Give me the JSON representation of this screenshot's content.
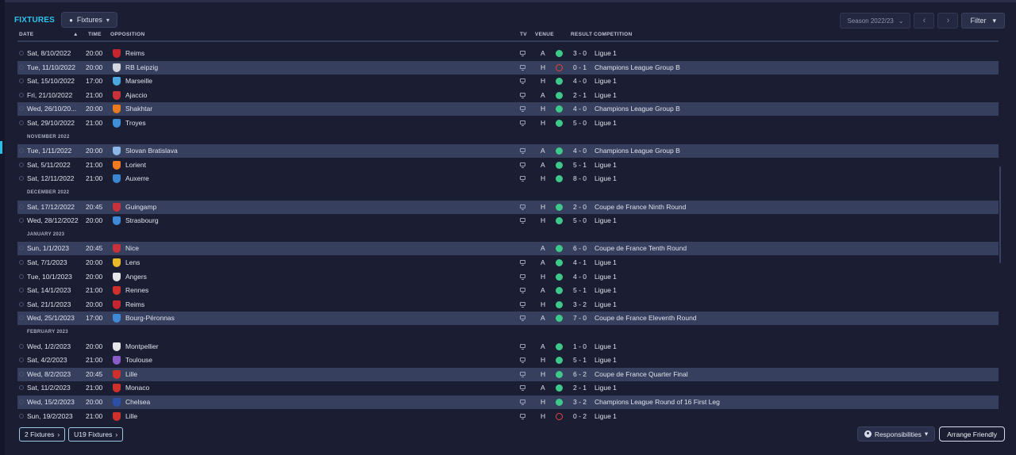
{
  "header": {
    "title": "FIXTURES",
    "view_dropdown": "Fixtures",
    "season": "Season 2022/23",
    "filter": "Filter"
  },
  "columns": {
    "date": "DATE",
    "time": "TIME",
    "opposition": "OPPOSITION",
    "tv": "TV",
    "venue": "VENUE",
    "result": "RESULT",
    "competition": "COMPETITION"
  },
  "rows": [
    {
      "type": "fixture",
      "date": "Sat, 8/10/2022",
      "time": "20:00",
      "opp": "Reims",
      "crest": "#c4252f",
      "tv": true,
      "venue": "A",
      "outcome": "win",
      "score": "3 - 0",
      "comp": "Ligue 1",
      "alt": false
    },
    {
      "type": "fixture",
      "date": "Tue, 11/10/2022",
      "time": "20:00",
      "opp": "RB Leipzig",
      "crest": "#d6d6e0",
      "tv": true,
      "venue": "H",
      "outcome": "loss",
      "score": "0 - 1",
      "comp": "Champions League Group B",
      "alt": true
    },
    {
      "type": "fixture",
      "date": "Sat, 15/10/2022",
      "time": "17:00",
      "opp": "Marseille",
      "crest": "#4aa8de",
      "tv": true,
      "venue": "H",
      "outcome": "win",
      "score": "4 - 0",
      "comp": "Ligue 1",
      "alt": false
    },
    {
      "type": "fixture",
      "date": "Fri, 21/10/2022",
      "time": "21:00",
      "opp": "Ajaccio",
      "crest": "#c8323a",
      "tv": true,
      "venue": "A",
      "outcome": "win",
      "score": "2 - 1",
      "comp": "Ligue 1",
      "alt": false
    },
    {
      "type": "fixture",
      "date": "Wed, 26/10/20...",
      "time": "20:00",
      "opp": "Shakhtar",
      "crest": "#e87a1c",
      "tv": true,
      "venue": "H",
      "outcome": "win",
      "score": "4 - 0",
      "comp": "Champions League Group B",
      "alt": true
    },
    {
      "type": "fixture",
      "date": "Sat, 29/10/2022",
      "time": "21:00",
      "opp": "Troyes",
      "crest": "#3f8fd8",
      "tv": true,
      "venue": "H",
      "outcome": "win",
      "score": "5 - 0",
      "comp": "Ligue 1",
      "alt": false
    },
    {
      "type": "month",
      "label": "NOVEMBER 2022"
    },
    {
      "type": "fixture",
      "date": "Tue, 1/11/2022",
      "time": "20:00",
      "opp": "Slovan Bratislava",
      "crest": "#8ab6e8",
      "tv": true,
      "venue": "A",
      "outcome": "win",
      "score": "4 - 0",
      "comp": "Champions League Group B",
      "alt": true
    },
    {
      "type": "fixture",
      "date": "Sat, 5/11/2022",
      "time": "21:00",
      "opp": "Lorient",
      "crest": "#f07a22",
      "tv": true,
      "venue": "A",
      "outcome": "win",
      "score": "5 - 1",
      "comp": "Ligue 1",
      "alt": false
    },
    {
      "type": "fixture",
      "date": "Sat, 12/11/2022",
      "time": "21:00",
      "opp": "Auxerre",
      "crest": "#3a86d0",
      "tv": true,
      "venue": "H",
      "outcome": "win",
      "score": "8 - 0",
      "comp": "Ligue 1",
      "alt": false
    },
    {
      "type": "month",
      "label": "DECEMBER 2022"
    },
    {
      "type": "fixture",
      "date": "Sat, 17/12/2022",
      "time": "20:45",
      "opp": "Guingamp",
      "crest": "#c8323a",
      "tv": true,
      "venue": "H",
      "outcome": "win",
      "score": "2 - 0",
      "comp": "Coupe de France Ninth Round",
      "alt": true
    },
    {
      "type": "fixture",
      "date": "Wed, 28/12/2022",
      "time": "20:00",
      "opp": "Strasbourg",
      "crest": "#3e8ad6",
      "tv": true,
      "venue": "H",
      "outcome": "win",
      "score": "5 - 0",
      "comp": "Ligue 1",
      "alt": false
    },
    {
      "type": "month",
      "label": "JANUARY 2023"
    },
    {
      "type": "fixture",
      "date": "Sun, 1/1/2023",
      "time": "20:45",
      "opp": "Nice",
      "crest": "#c8323a",
      "tv": false,
      "venue": "A",
      "outcome": "win",
      "score": "6 - 0",
      "comp": "Coupe de France Tenth Round",
      "alt": true
    },
    {
      "type": "fixture",
      "date": "Sat, 7/1/2023",
      "time": "20:00",
      "opp": "Lens",
      "crest": "#e8b828",
      "tv": true,
      "venue": "A",
      "outcome": "win",
      "score": "4 - 1",
      "comp": "Ligue 1",
      "alt": false
    },
    {
      "type": "fixture",
      "date": "Tue, 10/1/2023",
      "time": "20:00",
      "opp": "Angers",
      "crest": "#e6e6ea",
      "tv": true,
      "venue": "H",
      "outcome": "win",
      "score": "4 - 0",
      "comp": "Ligue 1",
      "alt": false
    },
    {
      "type": "fixture",
      "date": "Sat, 14/1/2023",
      "time": "21:00",
      "opp": "Rennes",
      "crest": "#d0302c",
      "tv": true,
      "venue": "A",
      "outcome": "win",
      "score": "5 - 1",
      "comp": "Ligue 1",
      "alt": false
    },
    {
      "type": "fixture",
      "date": "Sat, 21/1/2023",
      "time": "20:00",
      "opp": "Reims",
      "crest": "#c4252f",
      "tv": true,
      "venue": "H",
      "outcome": "win",
      "score": "3 - 2",
      "comp": "Ligue 1",
      "alt": false
    },
    {
      "type": "fixture",
      "date": "Wed, 25/1/2023",
      "time": "17:00",
      "opp": "Bourg-Péronnas",
      "crest": "#3e8ad6",
      "tv": true,
      "venue": "A",
      "outcome": "win",
      "score": "7 - 0",
      "comp": "Coupe de France Eleventh Round",
      "alt": true
    },
    {
      "type": "month",
      "label": "FEBRUARY 2023"
    },
    {
      "type": "fixture",
      "date": "Wed, 1/2/2023",
      "time": "20:00",
      "opp": "Montpellier",
      "crest": "#e6e6ea",
      "tv": true,
      "venue": "A",
      "outcome": "win",
      "score": "1 - 0",
      "comp": "Ligue 1",
      "alt": false
    },
    {
      "type": "fixture",
      "date": "Sat, 4/2/2023",
      "time": "21:00",
      "opp": "Toulouse",
      "crest": "#8a5cc8",
      "tv": true,
      "venue": "H",
      "outcome": "win",
      "score": "5 - 1",
      "comp": "Ligue 1",
      "alt": false
    },
    {
      "type": "fixture",
      "date": "Wed, 8/2/2023",
      "time": "20:45",
      "opp": "Lille",
      "crest": "#d0302c",
      "tv": true,
      "venue": "H",
      "outcome": "win",
      "score": "6 - 2",
      "comp": "Coupe de France Quarter Final",
      "alt": true
    },
    {
      "type": "fixture",
      "date": "Sat, 11/2/2023",
      "time": "21:00",
      "opp": "Monaco",
      "crest": "#d0302c",
      "tv": true,
      "venue": "A",
      "outcome": "win",
      "score": "2 - 1",
      "comp": "Ligue 1",
      "alt": false
    },
    {
      "type": "fixture",
      "date": "Wed, 15/2/2023",
      "time": "20:00",
      "opp": "Chelsea",
      "crest": "#2c4fa8",
      "tv": true,
      "venue": "H",
      "outcome": "win",
      "score": "3 - 2",
      "comp": "Champions League Round of 16  First Leg",
      "alt": true
    },
    {
      "type": "fixture",
      "date": "Sun, 19/2/2023",
      "time": "21:00",
      "opp": "Lille",
      "crest": "#d0302c",
      "tv": true,
      "venue": "H",
      "outcome": "loss",
      "score": "0 - 2",
      "comp": "Ligue 1",
      "alt": false
    }
  ],
  "footer": {
    "fixtures_link": "2 Fixtures",
    "u19_link": "U19 Fixtures",
    "responsibilities": "Responsibilities",
    "arrange": "Arrange Friendly"
  },
  "colors": {
    "accent": "#2fc4ea",
    "win": "#3ec98a",
    "loss": "#e0443e",
    "row_highlight": "#36405e",
    "background": "#1b1e33"
  }
}
